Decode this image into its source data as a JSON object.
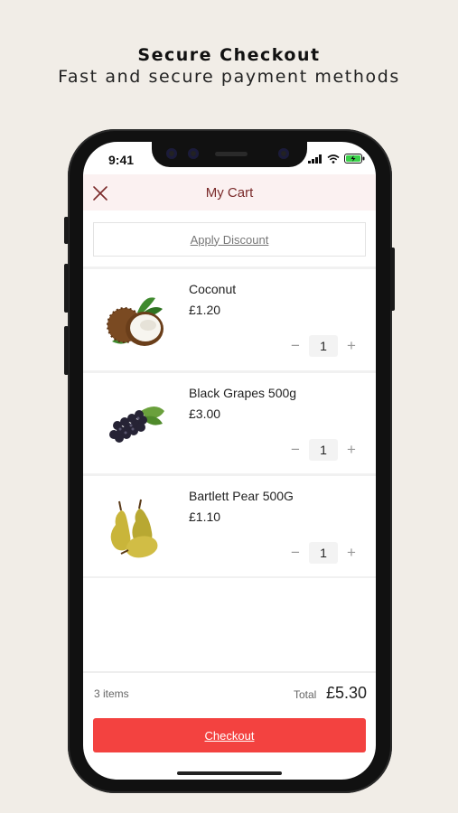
{
  "promo": {
    "title": "Secure Checkout",
    "subtitle": "Fast and secure payment methods"
  },
  "status_bar": {
    "time": "9:41",
    "icons": [
      "signal-icon",
      "wifi-icon",
      "battery-charging-icon"
    ]
  },
  "header": {
    "title": "My Cart",
    "close_icon": "close-icon"
  },
  "discount": {
    "label": "Apply Discount"
  },
  "cart": {
    "items": [
      {
        "name": "Coconut",
        "price": "£1.20",
        "quantity": "1",
        "image": "coconut-image"
      },
      {
        "name": "Black Grapes 500g",
        "price": "£3.00",
        "quantity": "1",
        "image": "grapes-image"
      },
      {
        "name": "Bartlett Pear 500G",
        "price": "£1.10",
        "quantity": "1",
        "image": "pear-image"
      }
    ]
  },
  "summary": {
    "count": "3 items",
    "total_label": "Total",
    "total_value": "£5.30"
  },
  "checkout": {
    "label": "Checkout"
  },
  "colors": {
    "background": "#f1ede7",
    "header_bg": "#fbf1f1",
    "header_text": "#7a2a2a",
    "checkout_bg": "#f34240"
  }
}
